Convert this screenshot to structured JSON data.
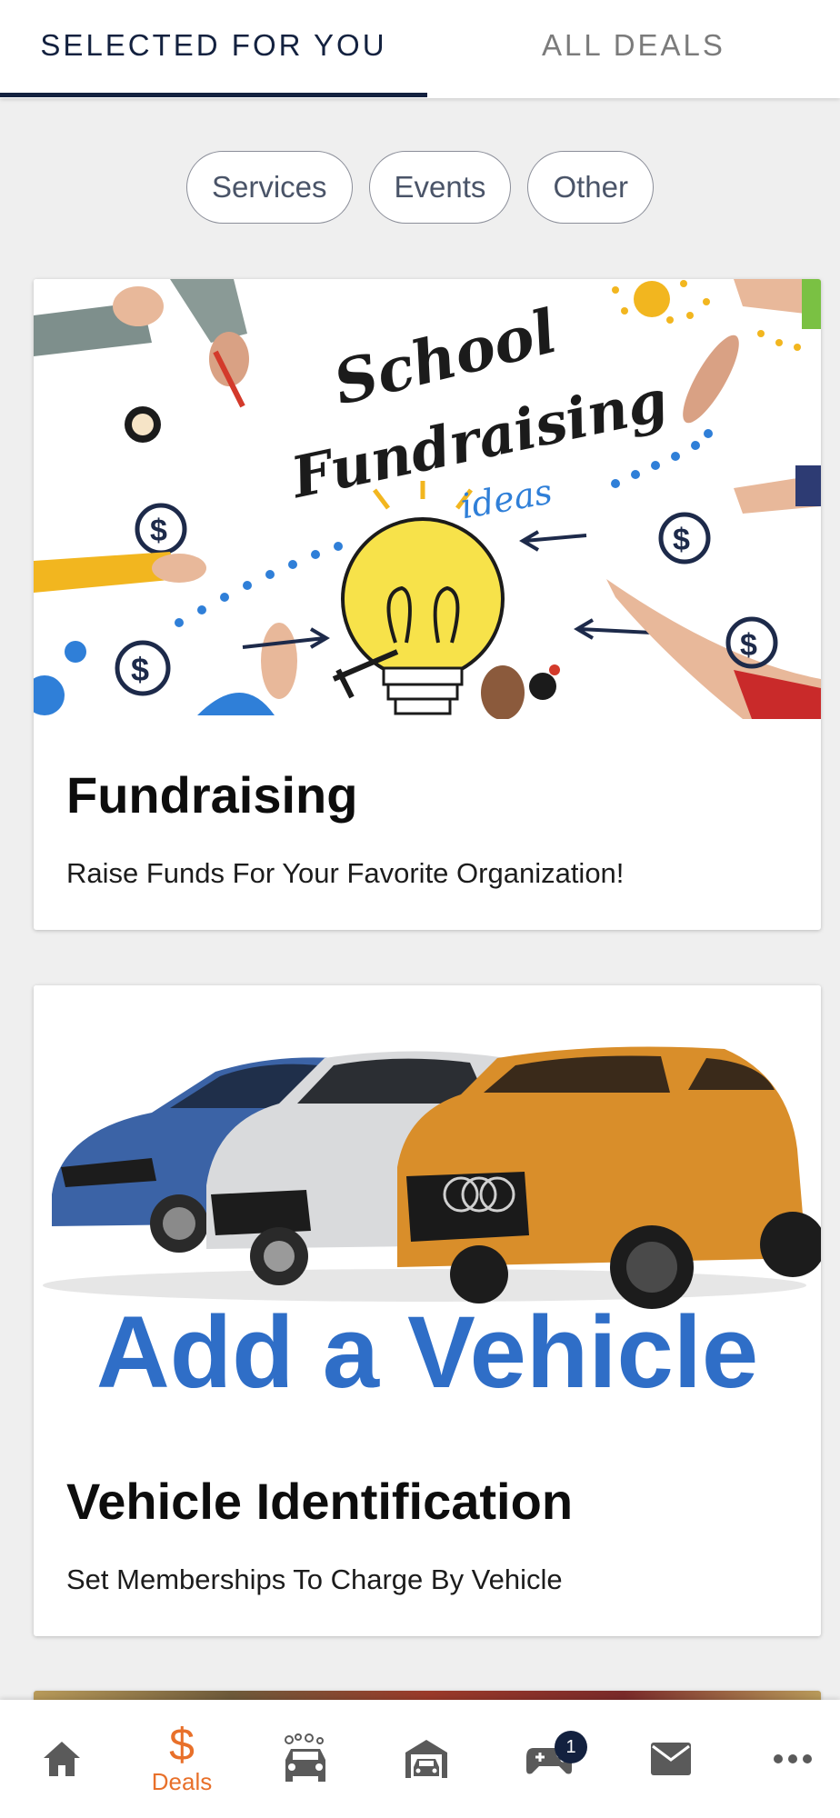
{
  "tabs": {
    "selected_label": "SELECTED FOR YOU",
    "all_label": "ALL DEALS"
  },
  "chips": [
    "Services",
    "Events",
    "Other"
  ],
  "cards": [
    {
      "title": "Fundraising",
      "subtitle": "Raise Funds For Your Favorite Organization!",
      "image_text_1": "School",
      "image_text_2": "Fundraising",
      "image_text_3": "ideas"
    },
    {
      "title": "Vehicle Identification",
      "subtitle": "Set Memberships To Charge By Vehicle",
      "image_text": "Add a Vehicle"
    }
  ],
  "bottom_nav": {
    "items": [
      {
        "icon": "home-icon"
      },
      {
        "icon": "dollar-icon",
        "symbol": "$",
        "label": "Deals"
      },
      {
        "icon": "car-wash-icon"
      },
      {
        "icon": "garage-car-icon"
      },
      {
        "icon": "gamepad-icon",
        "badge": "1"
      },
      {
        "icon": "mail-icon"
      },
      {
        "icon": "more-icon"
      }
    ]
  },
  "colors": {
    "navy": "#13213f",
    "accent_orange": "#e8702a",
    "vehicle_blue": "#2f6ec7"
  }
}
